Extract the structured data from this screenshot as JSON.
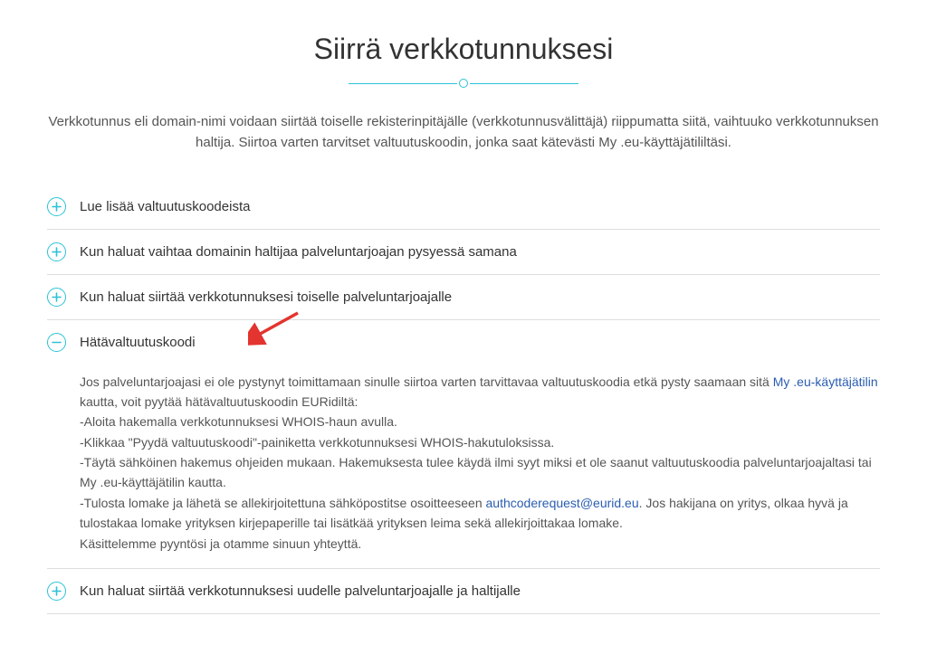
{
  "page": {
    "title": "Siirrä verkkotunnuksesi",
    "intro": "Verkkotunnus eli domain-nimi voidaan siirtää toiselle rekisterinpitäjälle (verkkotunnusvälittäjä) riippumatta siitä, vaihtuuko verkkotunnuksen haltija. Siirtoa varten tarvitset valtuutuskoodin, jonka saat kätevästi My .eu-käyttäjätililtäsi."
  },
  "accordion": [
    {
      "title": "Lue lisää valtuutuskoodeista",
      "expanded": false
    },
    {
      "title": "Kun haluat vaihtaa domainin haltijaa palveluntarjoajan pysyessä samana",
      "expanded": false
    },
    {
      "title": "Kun haluat siirtää verkkotunnuksesi toiselle palveluntarjoajalle",
      "expanded": false
    },
    {
      "title": "Hätävaltuutuskoodi",
      "expanded": true
    },
    {
      "title": "Kun haluat siirtää verkkotunnuksesi uudelle palveluntarjoajalle ja haltijalle",
      "expanded": false
    }
  ],
  "expanded_body": {
    "p1_pre": "Jos palveluntarjoajasi ei ole pystynyt toimittamaan sinulle siirtoa varten tarvittavaa valtuutuskoodia etkä pysty saamaan sitä ",
    "link1": "My .eu-käyttäjätilin",
    "p1_post": " kautta, voit pyytää hätävaltuutuskoodin EURidiltä:",
    "li1": "-Aloita hakemalla verkkotunnuksesi WHOIS-haun avulla.",
    "li2": "-Klikkaa \"Pyydä valtuutuskoodi\"-painiketta verkkotunnuksesi WHOIS-hakutuloksissa.",
    "li3": "-Täytä sähköinen hakemus ohjeiden mukaan. Hakemuksesta tulee käydä ilmi syyt miksi et ole saanut valtuutuskoodia palveluntarjoajaltasi tai My .eu-käyttäjätilin kautta.",
    "li4_pre": "-Tulosta lomake ja lähetä se allekirjoitettuna sähköpostitse osoitteeseen ",
    "link2": "authcoderequest@eurid.eu",
    "li4_post": ". Jos hakijana on yritys, olkaa hyvä ja tulostakaa lomake yrityksen kirjepaperille tai lisätkää yrityksen leima sekä allekirjoittakaa lomake.",
    "p2": "Käsittelemme pyyntösi ja otamme sinuun yhteyttä."
  }
}
